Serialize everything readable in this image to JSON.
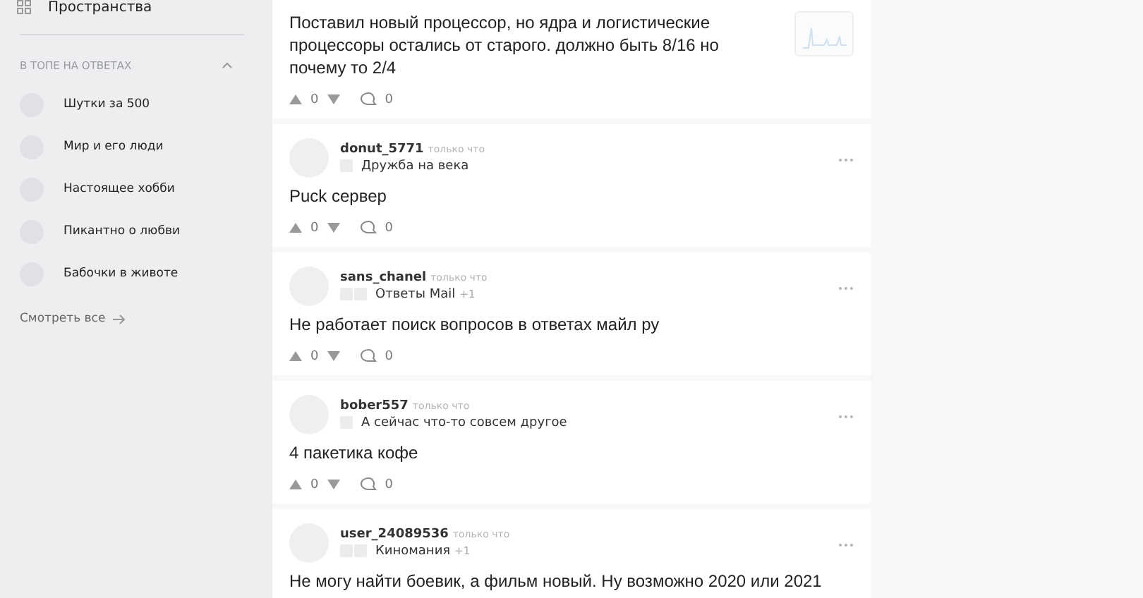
{
  "sidebar": {
    "spaces_link": "Пространства",
    "section": {
      "title": "В ТОПЕ НА ОТВЕТАХ",
      "expanded": true,
      "items": [
        {
          "label": "Шутки за 500"
        },
        {
          "label": "Мир и его люди"
        },
        {
          "label": "Настоящее хобби"
        },
        {
          "label": "Пикантно о любви"
        },
        {
          "label": "Бабочки в животе"
        }
      ]
    },
    "see_all": "Смотреть все"
  },
  "posts": [
    {
      "title": "Поставил новый процессор, но ядра и логистические процессоры остались от старого. должно быть 8/16 но почему то 2/4",
      "has_thumbnail": true,
      "votes": "0",
      "comments": "0"
    },
    {
      "author": "donut_5771",
      "time": "только что",
      "community": "Дружба на века",
      "title": "Puck сервер",
      "votes": "0",
      "comments": "0"
    },
    {
      "author": "sans_chanel",
      "time": "только что",
      "community": "Ответы Mail",
      "extra": "+1",
      "title": "Не работает поиск вопросов в ответах майл ру",
      "votes": "0",
      "comments": "0"
    },
    {
      "author": "bober557",
      "time": "только что",
      "community": "А сейчас что-то совсем другое",
      "title": "4 пакетика кофе",
      "votes": "0",
      "comments": "0"
    },
    {
      "author": "user_24089536",
      "time": "только что",
      "community": "Киномания",
      "extra": "+1",
      "title": "Не могу найти боевик, а фильм новый. Ну возможно 2020 или 2021"
    }
  ]
}
